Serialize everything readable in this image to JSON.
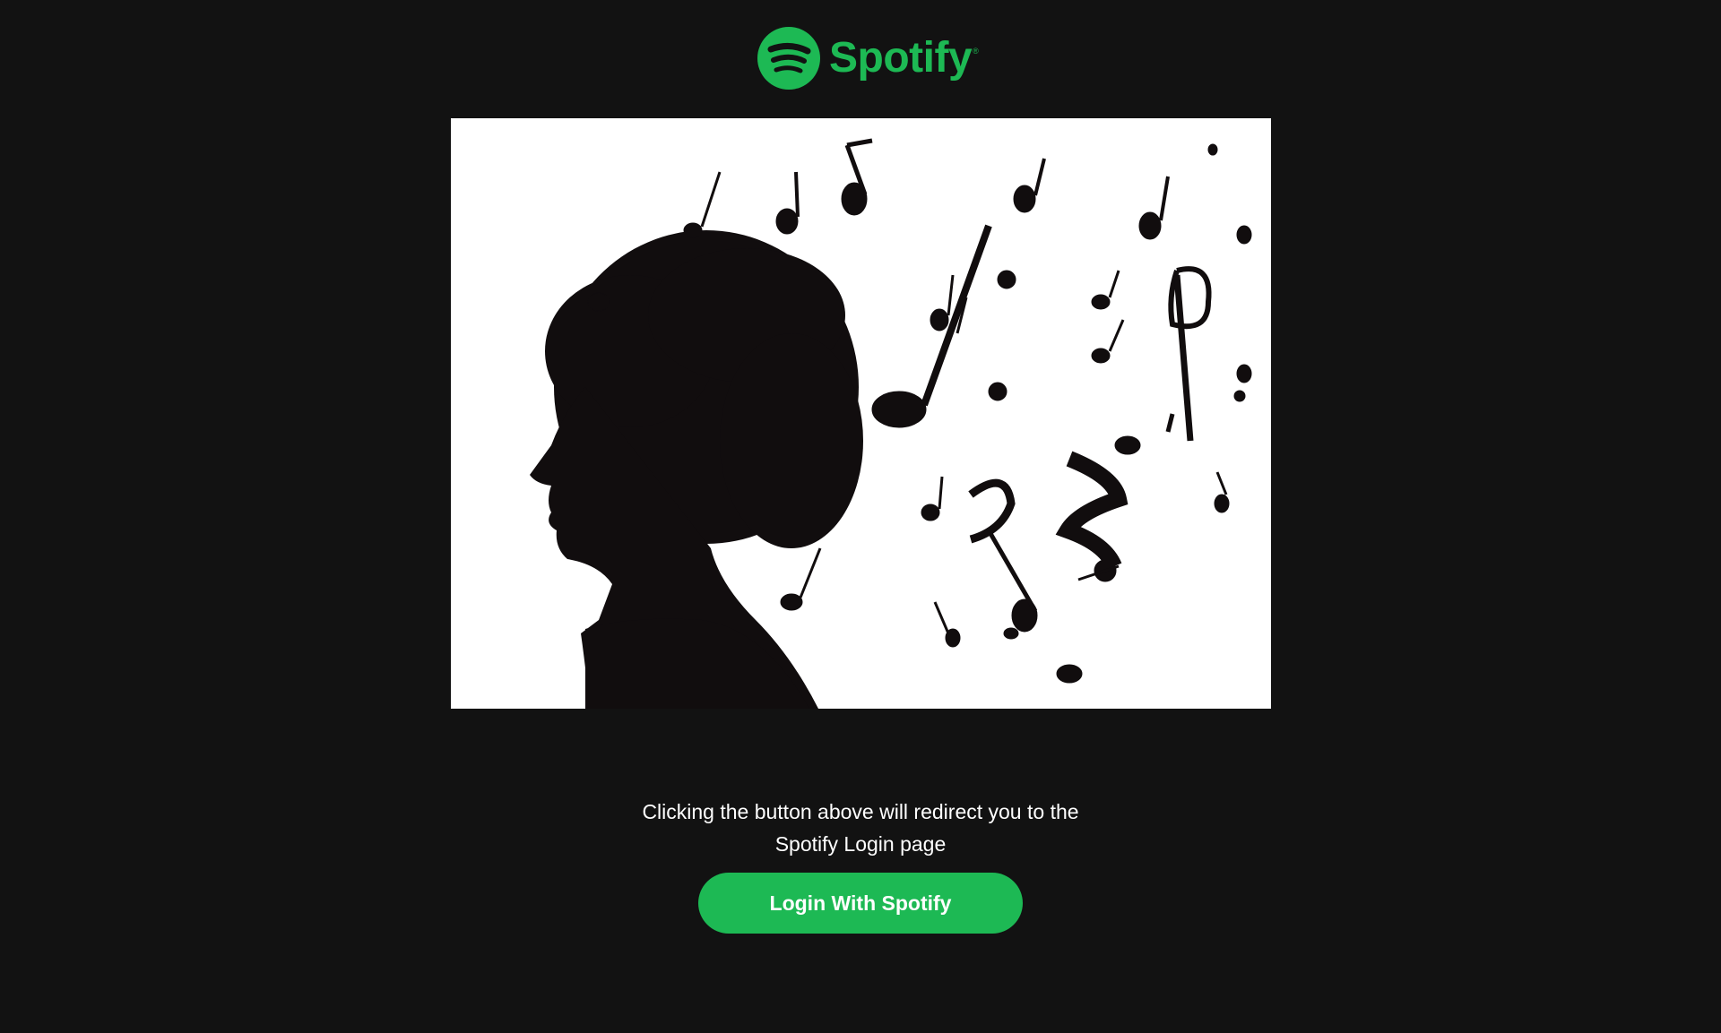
{
  "brand": {
    "name": "Spotify",
    "registered_mark": "®",
    "color": "#1DB954"
  },
  "hero": {
    "icon": "music-head-silhouette-icon"
  },
  "caption": {
    "line1": "Clicking the button above will redirect you to the",
    "line2": "Spotify Login page"
  },
  "login_button": {
    "label": "Login With Spotify"
  },
  "theme": {
    "background": "#121212",
    "text": "#ffffff"
  }
}
